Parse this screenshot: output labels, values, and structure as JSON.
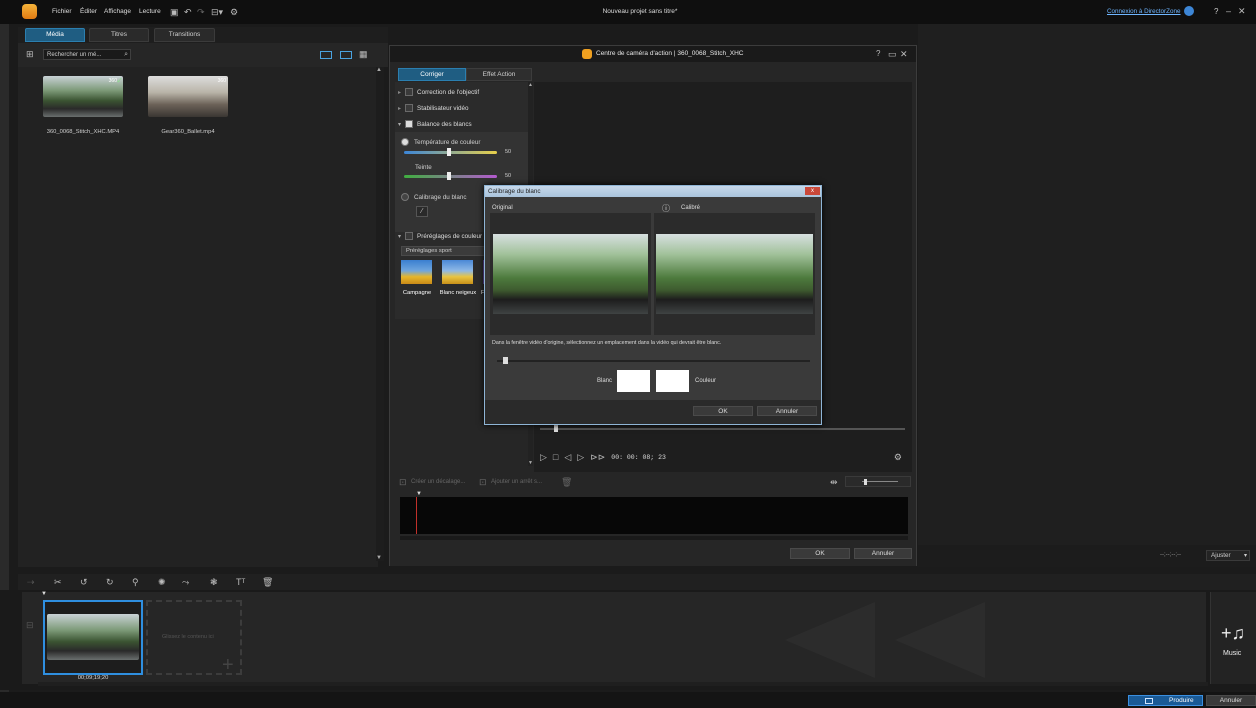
{
  "app": {
    "window_title": "Nouveau projet sans titre*",
    "menu": [
      "Fichier",
      "Éditer",
      "Affichage",
      "Lecture"
    ],
    "login_link": "Connexion à DirectorZone",
    "help": "?"
  },
  "library": {
    "tabs": [
      "Média",
      "Titres",
      "Transitions"
    ],
    "search_placeholder": "Rechercher un mé...",
    "items": [
      {
        "name": "360_0068_Stitch_XHC.MP4",
        "badge": "360"
      },
      {
        "name": "Gear360_Ballet.mp4",
        "badge": "360"
      }
    ]
  },
  "action_cam": {
    "title": "Centre de caméra d'action | 360_0068_Stitch_XHC",
    "tabs": [
      "Corriger",
      "Effet Action"
    ],
    "options": {
      "lens": "Correction de l'objectif",
      "stabilizer": "Stabilisateur vidéo",
      "white_balance": "Balance des blancs",
      "temp_label": "Température de couleur",
      "temp_value": "50",
      "tint_label": "Teinte",
      "tint_value": "50",
      "calib_label": "Calibrage du blanc",
      "presets_label": "Préréglages de couleur",
      "presets_select": "Préréglages sport",
      "presets": [
        "Campagne",
        "Blanc neigeux",
        "Fo"
      ]
    },
    "timecode": "00: 00: 08; 23",
    "lower_bar": [
      "Créer un décalage...",
      "Ajouter un arrêt s..."
    ],
    "ok": "OK",
    "cancel": "Annuler"
  },
  "wb_dialog": {
    "title": "Calibrage du blanc",
    "original": "Original",
    "calibrated": "Calibré",
    "instruction": "Dans la fenêtre vidéo d'origine, sélectionnez un emplacement dans la vidéo qui devrait être blanc.",
    "white_label": "Blanc",
    "color_label": "Couleur",
    "ok": "OK",
    "cancel": "Annuler",
    "close": "x"
  },
  "timeline": {
    "clip_time": "00;09;19;20",
    "drop_hint": "Glissez le contenu ici",
    "music_label": "Music",
    "fit_label": "Ajuster",
    "fit_time": "--;--;--;--"
  },
  "footer": {
    "produce": "Produire",
    "cancel": "Annuler"
  },
  "colors": {
    "accent": "#1f5d82",
    "accent_border": "#2b7fb0",
    "produce": "#1a5a96"
  }
}
